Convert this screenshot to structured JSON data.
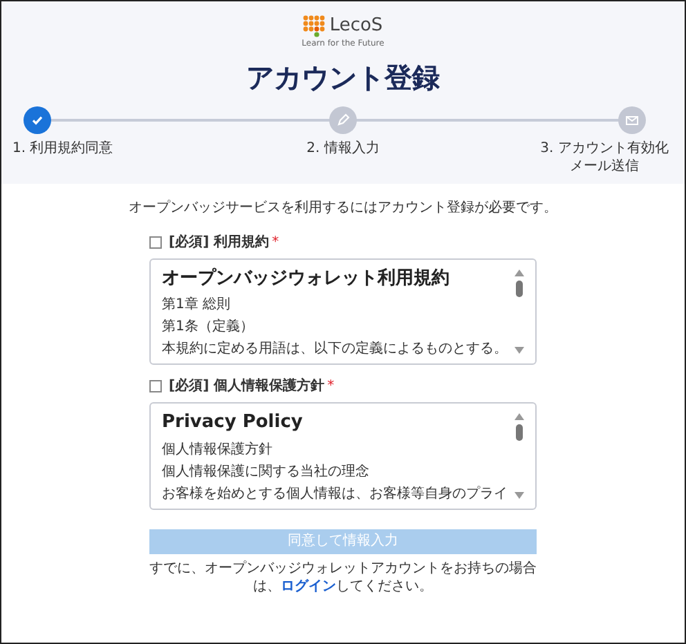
{
  "logo": {
    "name": "LecoS",
    "tagline": "Learn for the Future"
  },
  "title": "アカウント登録",
  "steps": [
    {
      "label": "1. 利用規約同意",
      "kind": "check",
      "done": true
    },
    {
      "label": "2. 情報入力",
      "kind": "pencil",
      "done": false
    },
    {
      "label": "3. アカウント有効化メール送信",
      "kind": "mail",
      "done": false
    }
  ],
  "intro": "オープンバッジサービスを利用するにはアカウント登録が必要です。",
  "agreements": [
    {
      "label": "[必須] 利用規約",
      "required_mark": "*",
      "checked": false,
      "heading": "オープンバッジウォレット利用規約",
      "lines": [
        "第1章 総則",
        "第1条（定義）",
        "本規約に定める用語は、以下の定義によるものとする。"
      ]
    },
    {
      "label": "[必須] 個人情報保護方針",
      "required_mark": "*",
      "checked": false,
      "heading": "Privacy Policy",
      "lines": [
        "個人情報保護方針",
        "個人情報保護に関する当社の理念",
        "お客様を始めとする個人情報は、お客様等自身のプライ"
      ]
    }
  ],
  "submit": {
    "label": "同意して情報入力",
    "disabled": true
  },
  "footer": {
    "before": "すでに、オープンバッジウォレットアカウントをお持ちの場合は、",
    "link": "ログイン",
    "after": "してください。"
  }
}
